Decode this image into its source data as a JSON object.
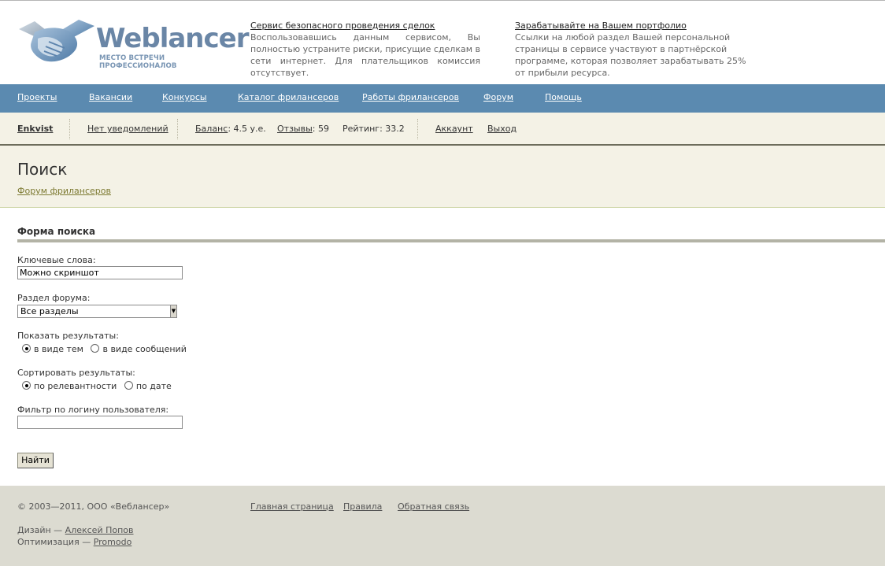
{
  "header": {
    "logo_word": "Weblancer",
    "logo_tagline": "МЕСТО ВСТРЕЧИ ПРОФЕССИОНАЛОВ",
    "promo1": {
      "link": "Сервис безопасного проведения сделок",
      "text": "Воспользовавшись данным сервисом, Вы полностью устраните риски, присущие сделкам в сети интернет. Для плательщиков комиссия отсутствует."
    },
    "promo2": {
      "link": "Зарабатывайте на Вашем портфолио",
      "text": "Ссылки на любой раздел Вашей персональной страницы в сервисе участвуют в партнёрской программе, которая позволяет зарабатывать 25% от прибыли ресурса."
    }
  },
  "nav": {
    "items": [
      "Проекты",
      "Вакансии",
      "Конкурсы",
      "Каталог фрилансеров",
      "Работы фрилансеров",
      "Форум",
      "Помощь"
    ]
  },
  "userbar": {
    "username": "Enkvist",
    "notifications": "Нет уведомлений",
    "balance_label": "Баланс",
    "balance_value": ": 4.5 у.е.",
    "reviews_label": "Отзывы",
    "reviews_value": ": 59",
    "rating": "Рейтинг: 33.2",
    "account": "Аккаунт",
    "logout": "Выход"
  },
  "page": {
    "title": "Поиск",
    "breadcrumb": "Форум фрилансеров"
  },
  "form": {
    "title": "Форма поиска",
    "keywords_label": "Ключевые слова:",
    "keywords_value": "Можно скриншот",
    "section_label": "Раздел форума:",
    "section_value": "Все разделы",
    "show_label": "Показать результаты:",
    "show_options": [
      "в виде тем",
      "в виде сообщений"
    ],
    "sort_label": "Сортировать результаты:",
    "sort_options": [
      "по релевантности",
      "по дате"
    ],
    "filter_label": "Фильтр по логину пользователя:",
    "filter_value": "",
    "submit": "Найти"
  },
  "footer": {
    "copyright": "© 2003—2011, ООО «Веблансер»",
    "links": [
      "Главная страница",
      "Правила",
      "Обратная связь"
    ],
    "design_prefix": "Дизайн — ",
    "design_name": "Алексей Попов",
    "optim_prefix": "Оптимизация — ",
    "optim_name": "Promodo"
  },
  "colors": {
    "nav_bg": "#5b8ab0",
    "userbar_bg": "#f4f2e6",
    "footer_bg": "#dcdbd1",
    "username": "#1d5a8a",
    "breadcrumb_link": "#7d7a32"
  },
  "icons": [
    "handshake-logo-icon",
    "select-arrow-icon"
  ]
}
